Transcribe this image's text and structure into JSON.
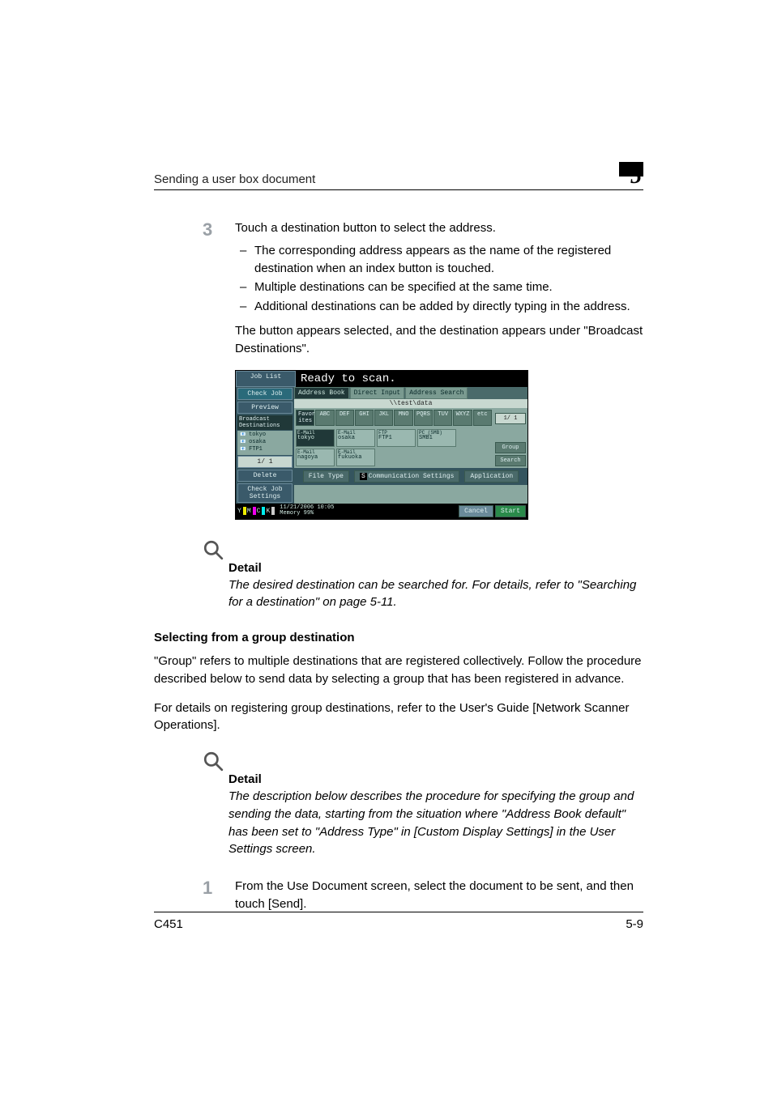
{
  "header": {
    "title": "Sending a user box document",
    "chapter_number": "5"
  },
  "step3": {
    "num": "3",
    "text": "Touch a destination button to select the address.",
    "bullets": [
      "The corresponding address appears as the name of the registered destination when an index button is touched.",
      "Multiple destinations can be specified at the same time.",
      "Additional destinations can be added by directly typing in the address."
    ],
    "after": "The button appears selected, and the destination appears under \"Broadcast Destinations\"."
  },
  "screenshot": {
    "job_list": "Job List",
    "status": "Ready to scan.",
    "check_job": "Check Job",
    "preview": "Preview",
    "tabs": {
      "address_book": "Address Book",
      "direct_input": "Direct Input",
      "search": "Address Search"
    },
    "path": "\\\\test\\data",
    "index": [
      "Favor-ites",
      "ABC",
      "DEF",
      "GHI",
      "JKL",
      "MNO",
      "PQRS",
      "TUV",
      "WXYZ",
      "etc"
    ],
    "destinations": [
      {
        "type": "E-Mail",
        "name": "tokyo",
        "sel": true
      },
      {
        "type": "E-Mail",
        "name": "osaka",
        "sel": false
      },
      {
        "type": "FTP",
        "name": "FTP1",
        "sel": false
      },
      {
        "type": "PC (SMB)",
        "name": "SMB1",
        "sel": false
      },
      {
        "type": "E-Mail",
        "name": "nagoya",
        "sel": false
      },
      {
        "type": "E-Mail",
        "name": "fukuoka",
        "sel": false
      }
    ],
    "page_indicator": "1/ 1",
    "broadcast_label": "Broadcast Destinations",
    "broadcast": [
      "tokyo",
      "osaka",
      "FTP1"
    ],
    "side_counter": "1/ 1",
    "delete": "Delete",
    "check_send": "Check Job Settings",
    "right_buttons": {
      "group": "Group",
      "search": "Search"
    },
    "bottom_tabs": {
      "file_type": "File Type",
      "comm": "Communication Settings",
      "application": "Application"
    },
    "toner": {
      "Y": "Y",
      "M": "M",
      "C": "C",
      "K": "K"
    },
    "datetime": "11/21/2006   10:05",
    "memory": "Memory        99%",
    "cancel": "Cancel",
    "start": "Start",
    "s_badge": "S"
  },
  "detail1": {
    "label": "Detail",
    "text": "The desired destination can be searched for. For details, refer to \"Searching for a destination\" on page 5-11."
  },
  "section_heading": "Selecting from a group destination",
  "para1": "\"Group\" refers to multiple destinations that are registered collectively. Follow the procedure described below to send data by selecting a group that has been registered in advance.",
  "para2": "For details on registering group destinations, refer to the User's Guide [Network Scanner Operations].",
  "detail2": {
    "label": "Detail",
    "text": "The description below describes the procedure for specifying the group and sending the data, starting from the situation where \"Address Book default\" has been set to \"Address Type\" in [Custom Display Settings] in the User Settings screen."
  },
  "step1": {
    "num": "1",
    "text": "From the Use Document screen, select the document to be sent, and then touch [Send]."
  },
  "footer": {
    "model": "C451",
    "page": "5-9"
  }
}
